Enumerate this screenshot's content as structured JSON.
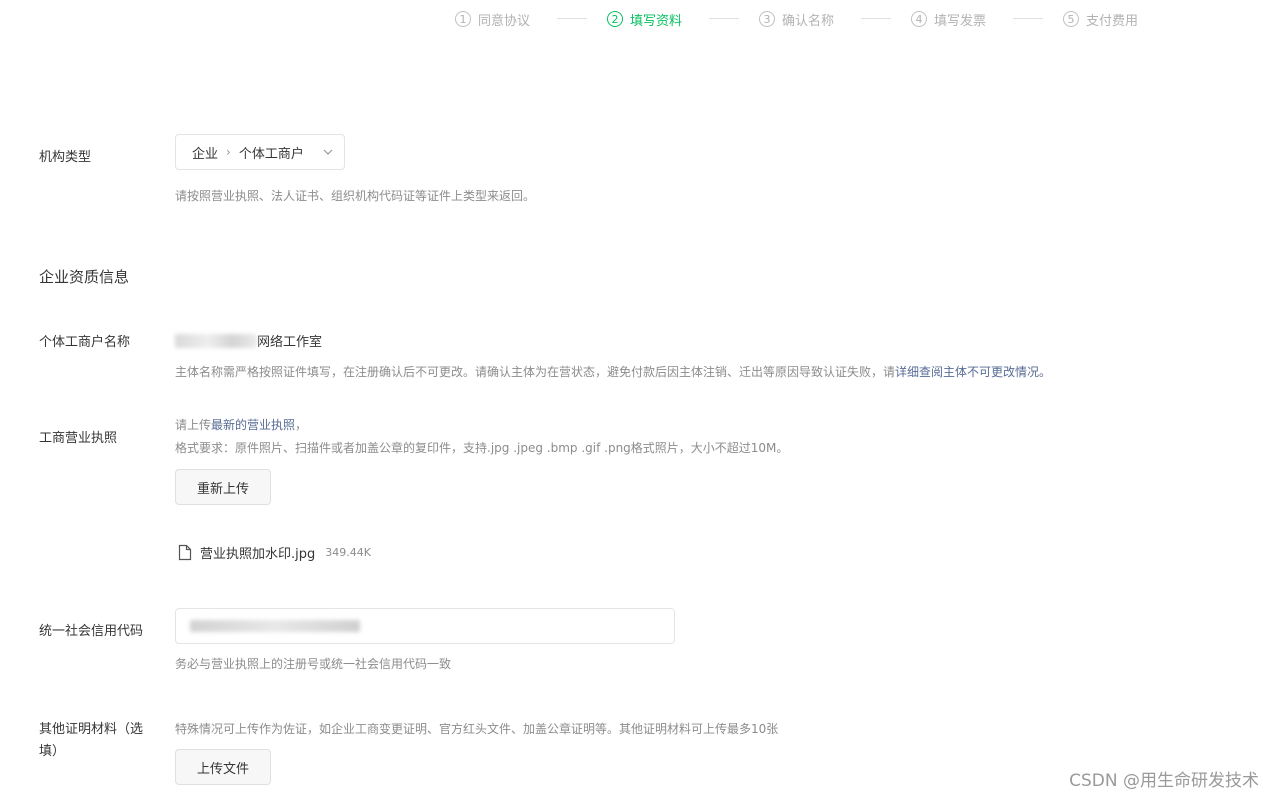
{
  "steps": [
    {
      "num": "1",
      "label": "同意协议",
      "active": false
    },
    {
      "num": "2",
      "label": "填写资料",
      "active": true
    },
    {
      "num": "3",
      "label": "确认名称",
      "active": false
    },
    {
      "num": "4",
      "label": "填写发票",
      "active": false
    },
    {
      "num": "5",
      "label": "支付费用",
      "active": false
    }
  ],
  "org_type": {
    "label": "机构类型",
    "value_parent": "企业",
    "value_child": "个体工商户",
    "hint": "请按照营业执照、法人证书、组织机构代码证等证件上类型来返回。"
  },
  "section_title": "企业资质信息",
  "business_name": {
    "label": "个体工商户名称",
    "value_suffix": "网络工作室",
    "hint_prefix": "主体名称需严格按照证件填写，在注册确认后不可更改。请确认主体为在营状态，避免付款后因主体注销、迁出等原因导致认证失败，请",
    "hint_link": "详细查阅主体不可更改情况。"
  },
  "license": {
    "label": "工商营业执照",
    "hint_line1_prefix": "请上传",
    "hint_line1_link": "最新的营业执照",
    "hint_line1_suffix": "，",
    "hint_line2": "格式要求：原件照片、扫描件或者加盖公章的复印件，支持.jpg .jpeg .bmp .gif .png格式照片，大小不超过10M。",
    "reupload_label": "重新上传",
    "file_name": "营业执照加水印.jpg",
    "file_size": "349.44K"
  },
  "credit_code": {
    "label": "统一社会信用代码",
    "hint": "务必与营业执照上的注册号或统一社会信用代码一致"
  },
  "other_docs": {
    "label_line1": "其他证明材料（选",
    "label_line2": "填）",
    "hint": "特殊情况可上传作为佐证，如企业工商变更证明、官方红头文件、加盖公章证明等。其他证明材料可上传最多10张",
    "upload_label": "上传文件"
  },
  "watermark": "CSDN @用生命研发技术",
  "colors": {
    "accent": "#07c160",
    "link": "#576b95",
    "hint": "#8c8c8c",
    "text": "#353535"
  }
}
